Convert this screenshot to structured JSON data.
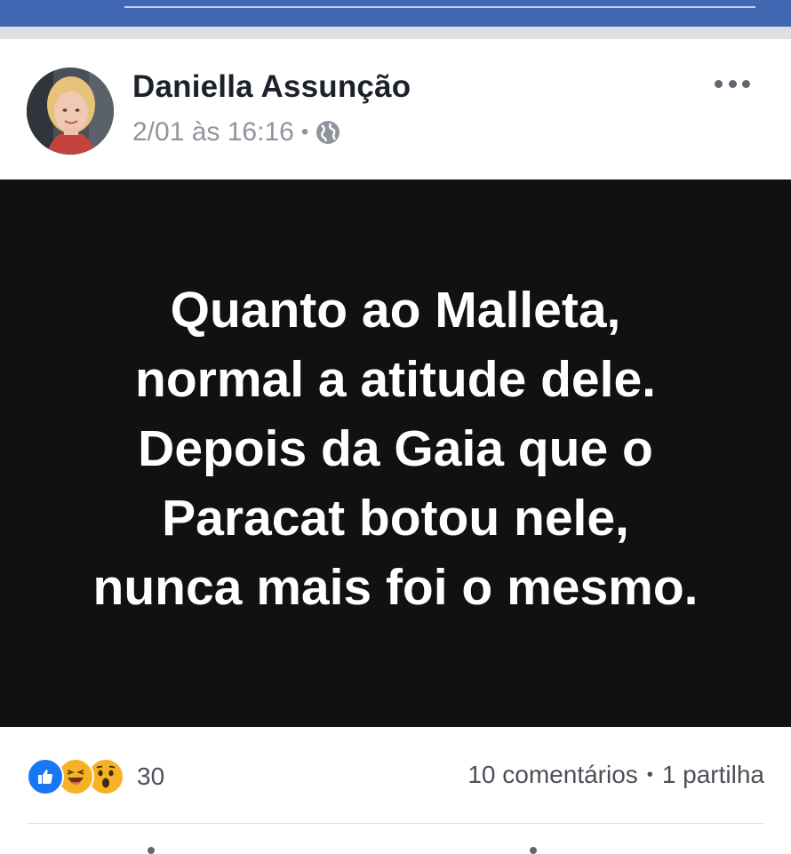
{
  "colors": {
    "topbar": "#4267b2",
    "image_background": "#111111",
    "like_blue": "#1877f2",
    "haha_yellow": "#f7b125"
  },
  "post": {
    "author": "Daniella Assunção",
    "timestamp": "2/01 às 16:16",
    "separator": "•",
    "privacy_icon": "globe-icon",
    "menu_icon": "more-options-icon",
    "image_text_lines": [
      "Quanto ao Malleta,",
      "normal a atitude dele.",
      "Depois da Gaia que o",
      "Paracat botou nele,",
      "nunca mais foi o mesmo."
    ]
  },
  "reactions": {
    "icons": [
      "like-icon",
      "haha-icon",
      "wow-icon"
    ],
    "count": "30"
  },
  "stats": {
    "comments": "10 comentários",
    "separator": "•",
    "shares": "1 partilha"
  }
}
